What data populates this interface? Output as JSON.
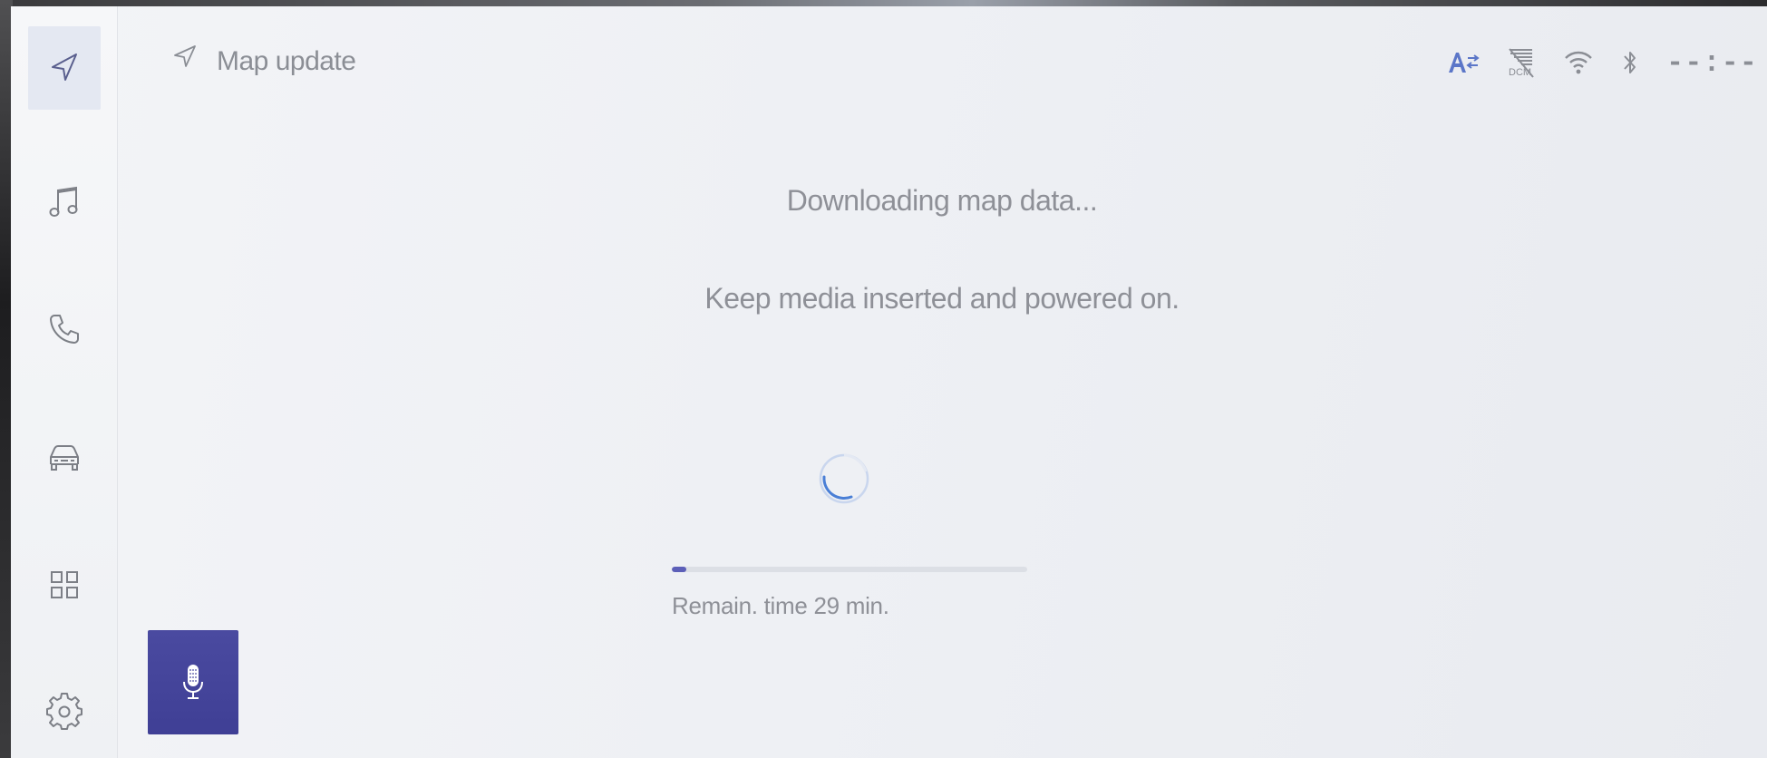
{
  "header": {
    "title": "Map update"
  },
  "status_bar": {
    "icons": [
      "text-direction-icon",
      "dcm-off-icon",
      "wifi-icon",
      "bluetooth-icon"
    ],
    "clock": "--:--"
  },
  "sidebar": {
    "items": [
      {
        "name": "navigation",
        "icon": "navigation-arrow-icon",
        "active": true
      },
      {
        "name": "audio",
        "icon": "music-note-icon",
        "active": false
      },
      {
        "name": "phone",
        "icon": "phone-icon",
        "active": false
      },
      {
        "name": "vehicle",
        "icon": "car-icon",
        "active": false
      },
      {
        "name": "apps",
        "icon": "apps-grid-icon",
        "active": false
      },
      {
        "name": "settings",
        "icon": "gear-icon",
        "active": false
      }
    ]
  },
  "voice": {
    "icon": "microphone-icon"
  },
  "main": {
    "status_message": "Downloading map data...",
    "instruction": "Keep media inserted and powered on.",
    "progress_fraction": 0.04,
    "remaining_time": "Remain. time 29 min."
  },
  "colors": {
    "accent": "#5c5fb8",
    "voice_button": "#4343 9a",
    "text": "#8e9097",
    "spinner": "#4a7fd6"
  }
}
